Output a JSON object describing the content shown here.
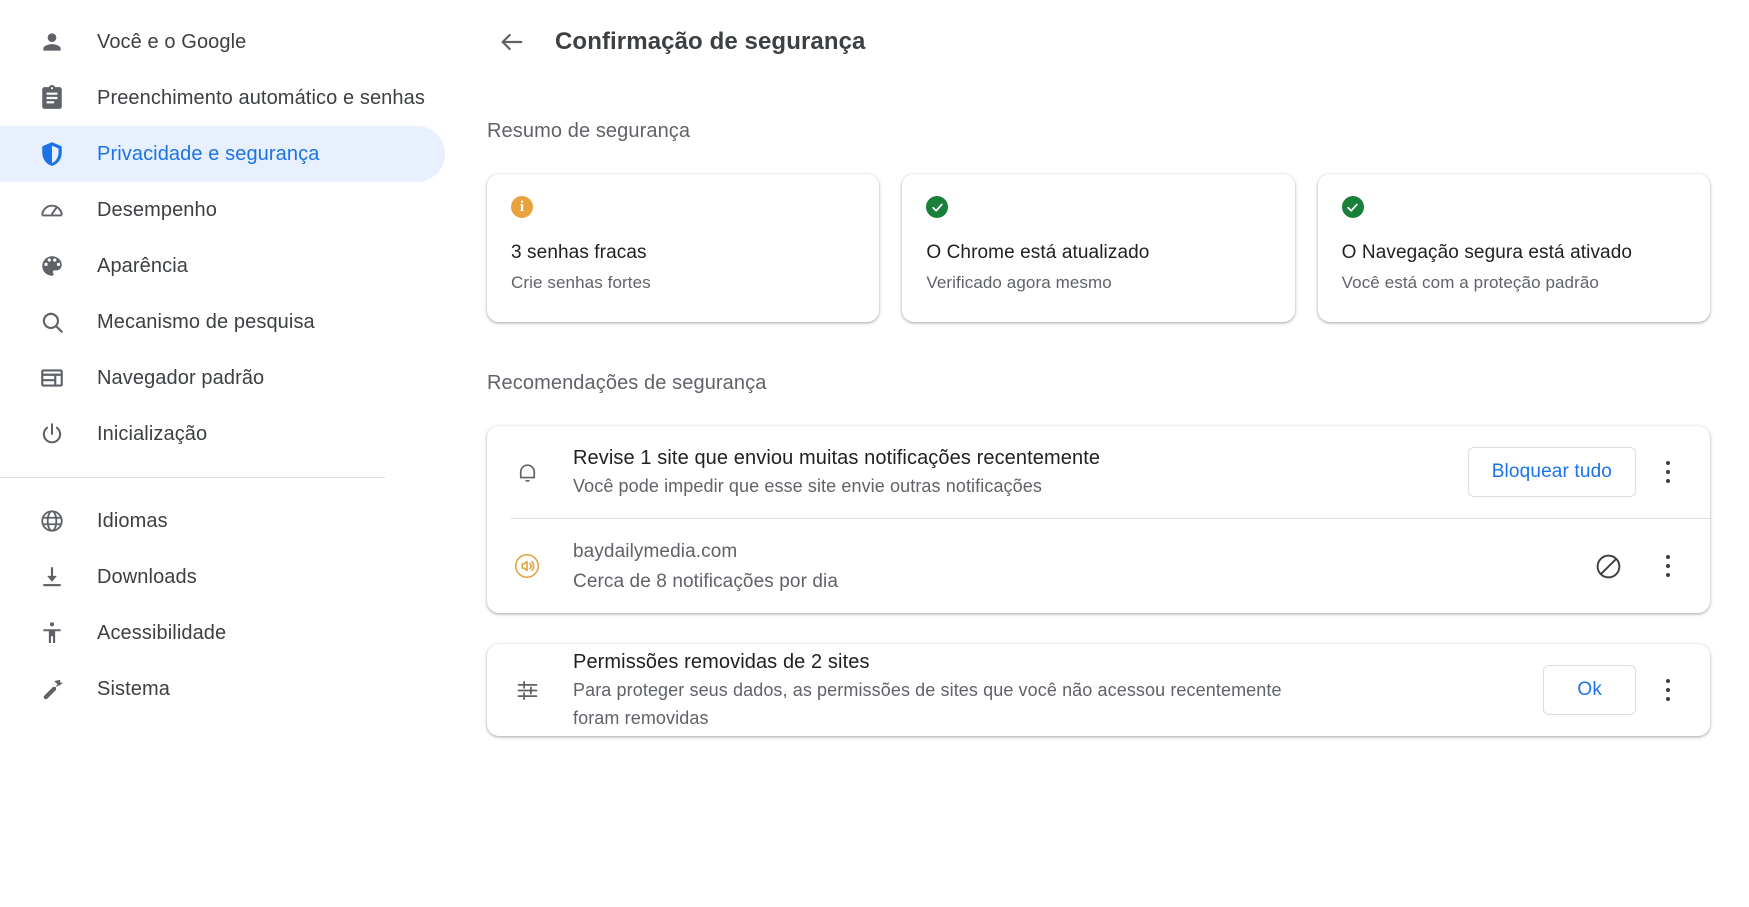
{
  "sidebar": {
    "items": [
      {
        "label": "Você e o Google",
        "icon": "person-icon",
        "name": "sidebar-item-you-and-google",
        "selected": false
      },
      {
        "label": "Preenchimento automático e senhas",
        "icon": "clipboard-icon",
        "name": "sidebar-item-autofill",
        "selected": false
      },
      {
        "label": "Privacidade e segurança",
        "icon": "shield-icon",
        "name": "sidebar-item-privacy-security",
        "selected": true
      },
      {
        "label": "Desempenho",
        "icon": "speedometer-icon",
        "name": "sidebar-item-performance",
        "selected": false
      },
      {
        "label": "Aparência",
        "icon": "palette-icon",
        "name": "sidebar-item-appearance",
        "selected": false
      },
      {
        "label": "Mecanismo de pesquisa",
        "icon": "search-icon",
        "name": "sidebar-item-search-engine",
        "selected": false
      },
      {
        "label": "Navegador padrão",
        "icon": "browser-icon",
        "name": "sidebar-item-default-browser",
        "selected": false
      },
      {
        "label": "Inicialização",
        "icon": "power-icon",
        "name": "sidebar-item-on-startup",
        "selected": false
      }
    ],
    "items_after_divider": [
      {
        "label": "Idiomas",
        "icon": "globe-icon",
        "name": "sidebar-item-languages",
        "selected": false
      },
      {
        "label": "Downloads",
        "icon": "download-icon",
        "name": "sidebar-item-downloads",
        "selected": false
      },
      {
        "label": "Acessibilidade",
        "icon": "accessibility-icon",
        "name": "sidebar-item-accessibility",
        "selected": false
      },
      {
        "label": "Sistema",
        "icon": "wrench-icon",
        "name": "sidebar-item-system",
        "selected": false
      }
    ]
  },
  "header": {
    "back_icon": "arrow-back-icon",
    "title": "Confirmação de segurança"
  },
  "summary": {
    "section_label": "Resumo de segurança",
    "cards": [
      {
        "icon": "info-badge-icon",
        "icon_glyph": "i",
        "status": "warning",
        "status_color": "#e8a33d",
        "title": "3 senhas fracas",
        "subtitle": "Crie senhas fortes"
      },
      {
        "icon": "check-badge-icon",
        "icon_glyph": "✓",
        "status": "ok",
        "status_color": "#188038",
        "title": "O Chrome está atualizado",
        "subtitle": "Verificado agora mesmo"
      },
      {
        "icon": "check-badge-icon",
        "icon_glyph": "✓",
        "status": "ok",
        "status_color": "#188038",
        "title": "O Navegação segura está ativado",
        "subtitle": "Você está com a proteção padrão"
      }
    ]
  },
  "recommendations": {
    "section_label": "Recomendações de segurança",
    "notifications_card": {
      "lead_icon": "bell-icon",
      "title": "Revise 1 site que enviou muitas notificações recentemente",
      "subtitle": "Você pode impedir que esse site envie outras notificações",
      "action_label": "Bloquear tudo",
      "overflow_icon": "more-vert-icon",
      "site": {
        "favicon": "sound-on-icon",
        "favicon_color": "#e8a33d",
        "name": "baydailymedia.com",
        "detail": "Cerca de 8 notificações por dia",
        "block_icon": "block-icon",
        "overflow_icon": "more-vert-icon"
      }
    },
    "permissions_card": {
      "lead_icon": "tune-icon",
      "title": "Permissões removidas de 2 sites",
      "subtitle_line1": "Para proteger seus dados, as permissões de sites que você não acessou recentemente",
      "subtitle_line2": "foram removidas",
      "action_label": "Ok",
      "overflow_icon": "more-vert-icon"
    }
  },
  "theme": {
    "accent": "#1a73e8",
    "selected_bg": "#e8f0fe",
    "text_primary": "#202124",
    "text_secondary": "#5f6368"
  }
}
